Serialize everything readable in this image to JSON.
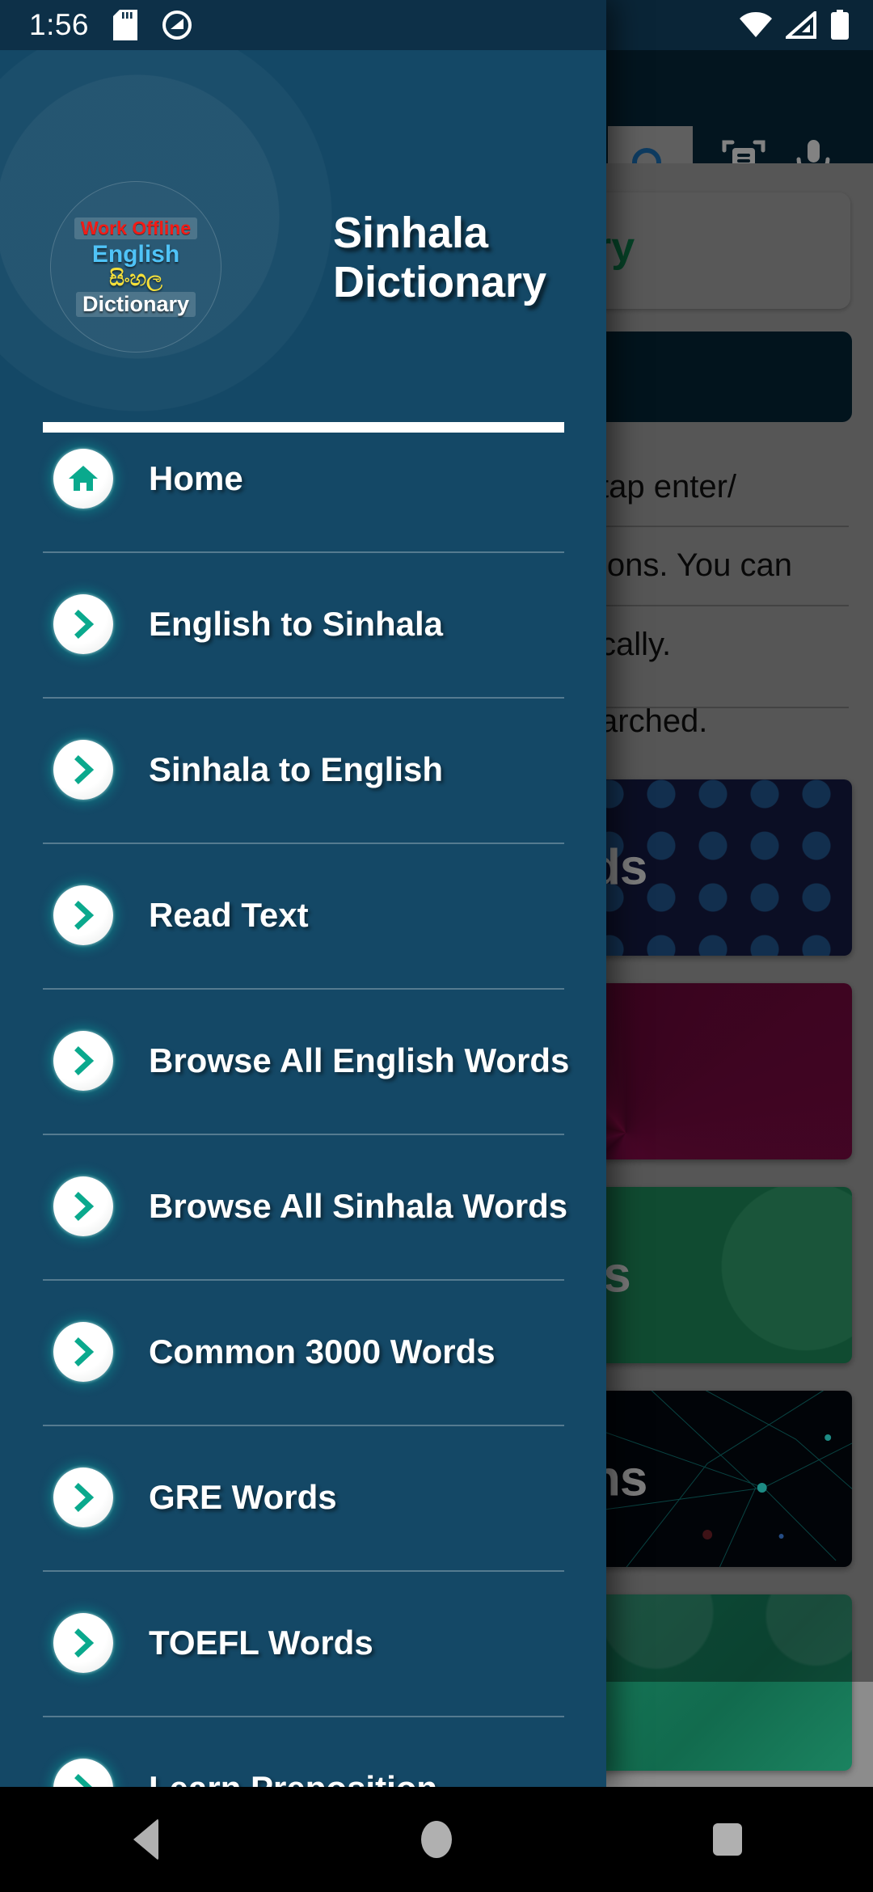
{
  "status_bar": {
    "time": "1:56",
    "icons": [
      "sd-card-icon",
      "do-not-disturb-icon",
      "wifi-icon",
      "cellular-signal-icon",
      "battery-icon"
    ]
  },
  "drawer": {
    "logo": {
      "work_offline": "Work Offline",
      "english": "English",
      "sinhala": "සිංහල",
      "dictionary": "Dictionary"
    },
    "app_title": "Sinhala Dictionary",
    "items": [
      {
        "label": "Home",
        "icon": "home-icon"
      },
      {
        "label": "English to Sinhala",
        "icon": "chevron-right-icon"
      },
      {
        "label": "Sinhala to English",
        "icon": "chevron-right-icon"
      },
      {
        "label": "Read Text",
        "icon": "chevron-right-icon"
      },
      {
        "label": "Browse All English Words",
        "icon": "chevron-right-icon"
      },
      {
        "label": "Browse All Sinhala Words",
        "icon": "chevron-right-icon"
      },
      {
        "label": "Common 3000 Words",
        "icon": "chevron-right-icon"
      },
      {
        "label": "GRE Words",
        "icon": "chevron-right-icon"
      },
      {
        "label": "TOEFL Words",
        "icon": "chevron-right-icon"
      },
      {
        "label": "Learn Preposition",
        "icon": "chevron-right-icon"
      }
    ]
  },
  "background_app": {
    "toolbar": {
      "search_icon": "search-icon",
      "scan_text_icon": "scan-text-icon",
      "voice_search_icon": "microphone-icon"
    },
    "card_title_fragment": "ry",
    "text_fragments": [
      "tap enter/",
      "ions. You can",
      "cally.",
      "arched."
    ],
    "banners": [
      {
        "text_fragment": "ds",
        "style": "dots-navy"
      },
      {
        "text_fragment": "",
        "style": "magenta-rays"
      },
      {
        "text_fragment": "ls",
        "style": "green-circle"
      },
      {
        "text_fragment": "ns",
        "style": "network-dark"
      },
      {
        "text_fragment": "",
        "style": "teal-shapes"
      }
    ]
  },
  "nav_bar": {
    "back": "back-button",
    "home": "home-button",
    "recents": "recents-button"
  },
  "colors": {
    "drawer_bg": "#144866",
    "status_bar": "#0d3048",
    "accent_teal": "#00a98f",
    "toolbar_dark": "#052232"
  }
}
